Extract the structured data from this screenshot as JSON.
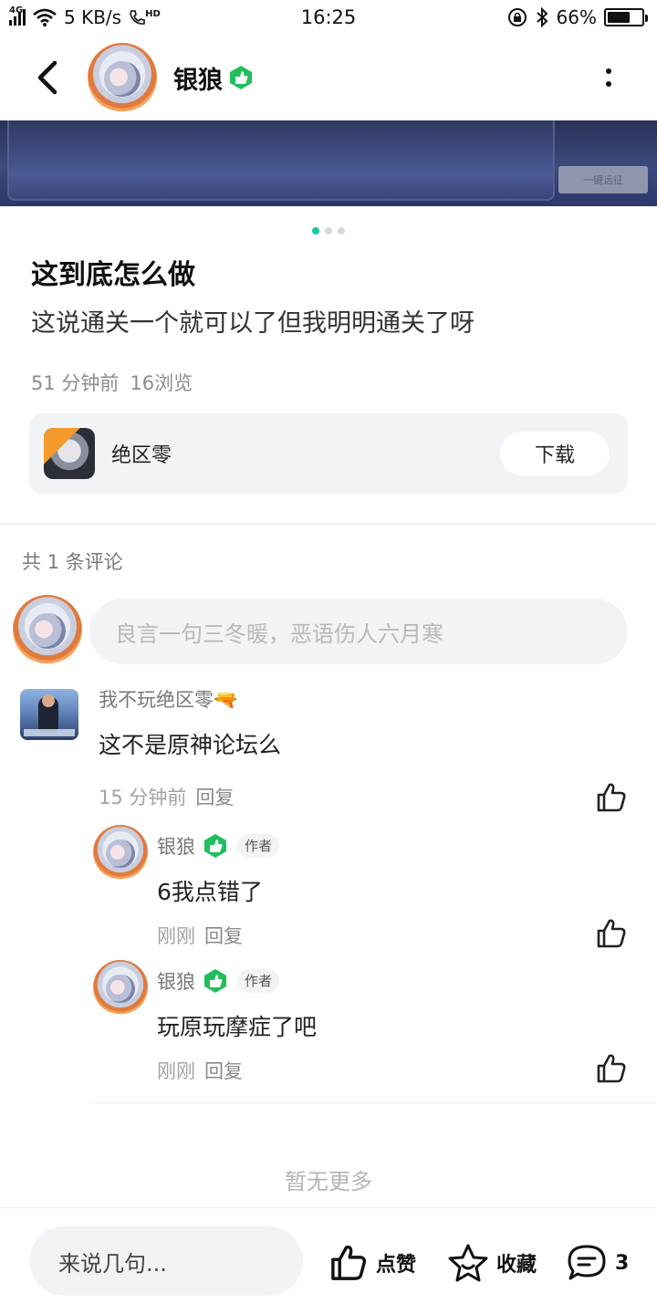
{
  "status_bar": {
    "network_tag": "4G",
    "speed": "5 KB/s",
    "hd": "HD",
    "time": "16:25",
    "battery": "66%",
    "battery_level": 0.66
  },
  "header": {
    "user_name": "银狼"
  },
  "banner": {
    "button_label": "一键远征"
  },
  "post": {
    "title": "这到底怎么做",
    "body": "这说通关一个就可以了但我明明通关了呀",
    "time": "51 分钟前",
    "views": "16浏览"
  },
  "game_card": {
    "name": "绝区零",
    "download_label": "下载"
  },
  "comments_section": {
    "count_text": "共 1 条评论",
    "input_placeholder": "良言一句三冬暖，恶语伤人六月寒",
    "no_more": "暂无更多"
  },
  "comment": {
    "author": "我不玩绝区零🔫",
    "text": "这不是原神论坛么",
    "time": "15 分钟前",
    "reply_label": "回复"
  },
  "replies": [
    {
      "author": "银狼",
      "author_tag": "作者",
      "text": "6我点错了",
      "time": "刚刚",
      "reply_label": "回复"
    },
    {
      "author": "银狼",
      "author_tag": "作者",
      "text": "玩原玩摩症了吧",
      "time": "刚刚",
      "reply_label": "回复"
    }
  ],
  "bottom_bar": {
    "input_placeholder": "来说几句...",
    "like_label": "点赞",
    "favorite_label": "收藏",
    "comment_count": "3"
  },
  "colors": {
    "accent": "#19c6a5",
    "badge_green": "#1fbf5c"
  }
}
